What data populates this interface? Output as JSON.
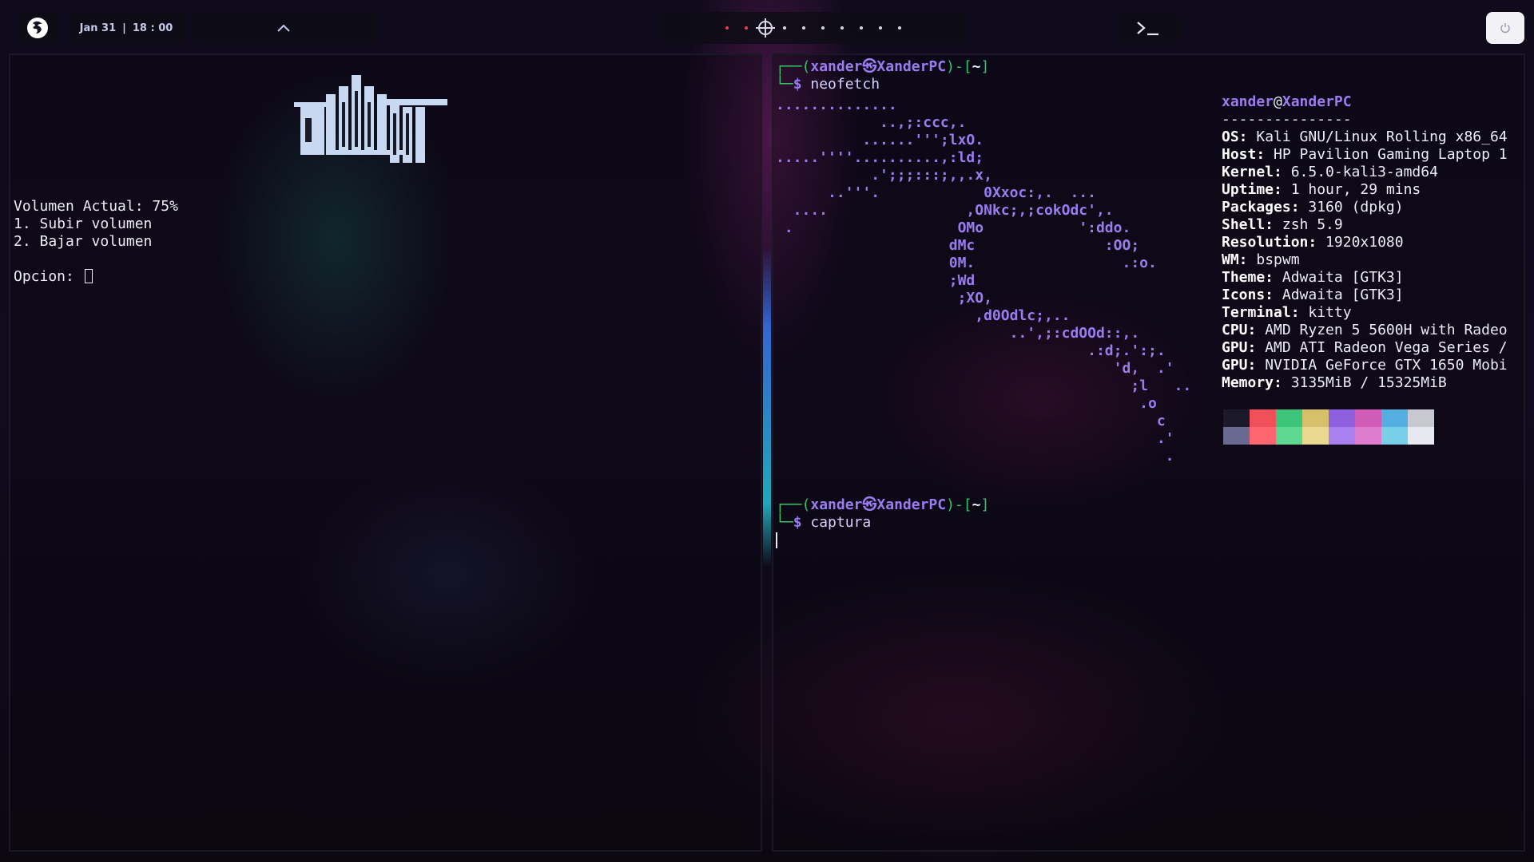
{
  "topbar": {
    "logo_icon": "kali-dragon-icon",
    "date": "Jan 31",
    "separator": "|",
    "time": "18 : 00",
    "tray_icon": "chevron-up-icon",
    "workspaces": [
      {
        "state": "occupied"
      },
      {
        "state": "occupied"
      },
      {
        "state": "active"
      },
      {
        "state": "empty"
      },
      {
        "state": "empty"
      },
      {
        "state": "empty"
      },
      {
        "state": "empty"
      },
      {
        "state": "empty"
      },
      {
        "state": "empty"
      },
      {
        "state": "empty"
      }
    ],
    "terminal_glyph": ">_",
    "power_icon": "power-icon"
  },
  "colors": {
    "accent_purple": "#9b7cf0",
    "prompt_green": "#32c56a",
    "workspace_occupied": "#e8414f",
    "glow_blue": "#3a7cff",
    "glow_cyan": "#23d0e0"
  },
  "left_terminal": {
    "volume_line": "Volumen Actual: 75%",
    "option_1": "1. Subir volumen",
    "option_2": "2. Bajar volumen",
    "prompt": "Opcion: ",
    "volume_level_percent": 75
  },
  "right_terminal": {
    "prompt1": {
      "open": "┌──(",
      "user": "xander",
      "at": "㉿",
      "host": "XanderPC",
      "close": ")-[",
      "dir": "~",
      "end": "]"
    },
    "cmd1_prefix": "└─",
    "cmd1_dollar": "$",
    "cmd1": "neofetch",
    "prompt2": {
      "open": "┌──(",
      "user": "xander",
      "at": "㉿",
      "host": "XanderPC",
      "close": ")-[",
      "dir": "~",
      "end": "]"
    },
    "cmd2_prefix": "└─",
    "cmd2_dollar": "$",
    "cmd2": "captura",
    "ascii_art": [
      "..............",
      "            ..,;:ccc,.",
      "          ......''';lxO.",
      ".....''''..........,:ld;",
      "           .';;;:::;,,.x,",
      "      ..'''.            0Xxoc:,.  ...",
      "  ....                ,ONkc;,;cokOdc',.",
      " .                   OMo           ':ddo.",
      "                    dMc               :OO;",
      "                    0M.                 .:o.",
      "                    ;Wd",
      "                     ;XO,",
      "                       ,d0Odlc;,..",
      "                           ..',;:cdOOd::,.",
      "                                    .:d;.':;.",
      "                                       'd,  .'",
      "                                         ;l   ..",
      "                                          .o",
      "                                            c",
      "                                            .'",
      "                                             ."
    ],
    "info_header": {
      "user": "xander",
      "at": "@",
      "host": "XanderPC"
    },
    "info_sep": "---------------",
    "info": [
      {
        "k": "OS",
        "v": " Kali GNU/Linux Rolling x86_64"
      },
      {
        "k": "Host",
        "v": " HP Pavilion Gaming Laptop 1"
      },
      {
        "k": "Kernel",
        "v": " 6.5.0-kali3-amd64"
      },
      {
        "k": "Uptime",
        "v": " 1 hour, 29 mins"
      },
      {
        "k": "Packages",
        "v": " 3160 (dpkg)"
      },
      {
        "k": "Shell",
        "v": " zsh 5.9"
      },
      {
        "k": "Resolution",
        "v": " 1920x1080"
      },
      {
        "k": "WM",
        "v": " bspwm"
      },
      {
        "k": "Theme",
        "v": " Adwaita [GTK3]"
      },
      {
        "k": "Icons",
        "v": " Adwaita [GTK3]"
      },
      {
        "k": "Terminal",
        "v": " kitty"
      },
      {
        "k": "CPU",
        "v": " AMD Ryzen 5 5600H with Radeo"
      },
      {
        "k": "GPU",
        "v": " AMD ATI Radeon Vega Series /"
      },
      {
        "k": "GPU",
        "v": " NVIDIA GeForce GTX 1650 Mobi"
      },
      {
        "k": "Memory",
        "v": " 3135MiB / 15325MiB"
      }
    ],
    "palette_top": [
      "#1c1a2a",
      "#f0505a",
      "#3cc47a",
      "#d6c06a",
      "#8e60e0",
      "#d05cb8",
      "#55aee0",
      "#c8c8d0"
    ],
    "palette_bottom": [
      "#6a6a90",
      "#ff6670",
      "#5ed890",
      "#e8d890",
      "#a880f0",
      "#e07cd0",
      "#78d0e8",
      "#e8e8f0"
    ]
  }
}
